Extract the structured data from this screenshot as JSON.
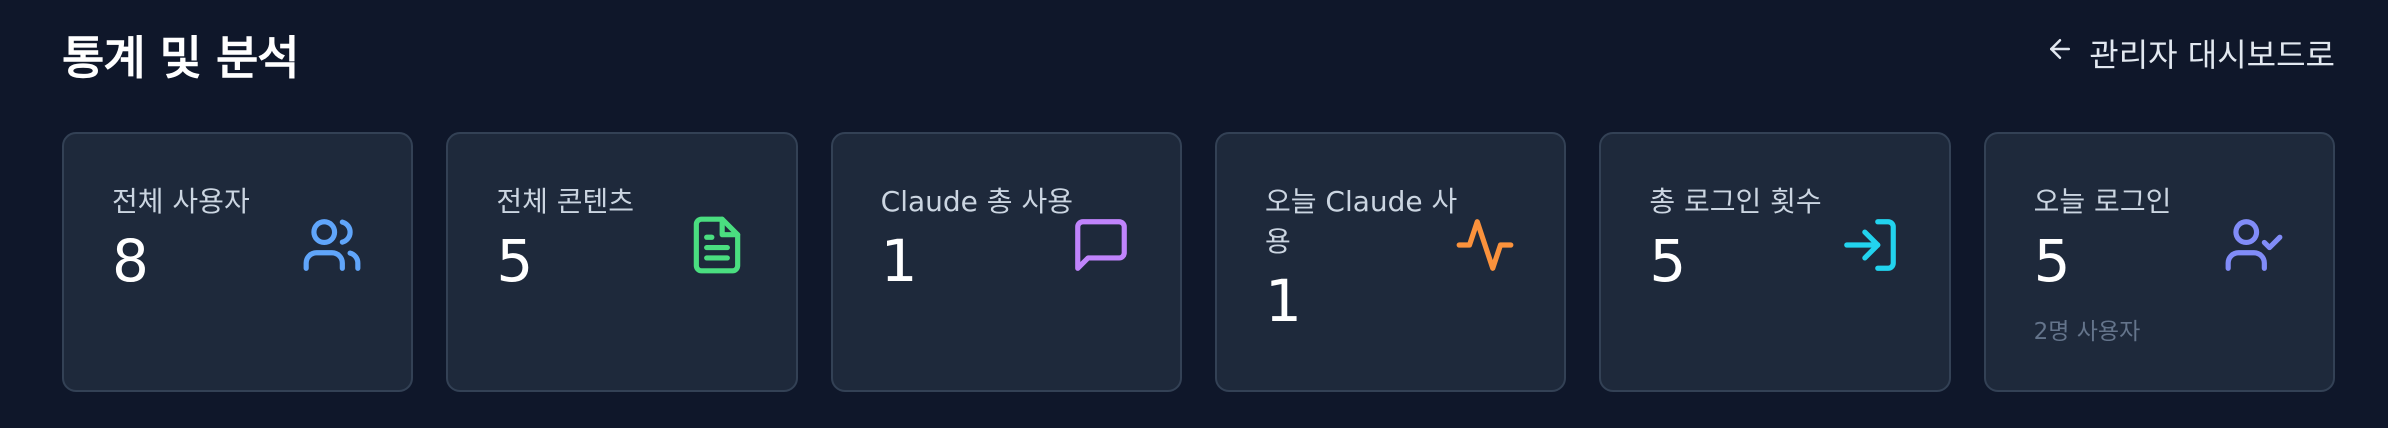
{
  "header": {
    "title": "통계 및 분석",
    "back_label": "관리자 대시보드로"
  },
  "cards": [
    {
      "label": "전체 사용자",
      "value": "8",
      "icon": "users-icon",
      "color": "#60a5fa"
    },
    {
      "label": "전체 콘텐츠",
      "value": "5",
      "icon": "file-text-icon",
      "color": "#4ade80"
    },
    {
      "label": "Claude 총 사용",
      "value": "1",
      "icon": "message-square-icon",
      "color": "#c084fc"
    },
    {
      "label": "오늘 Claude 사용",
      "value": "1",
      "icon": "activity-icon",
      "color": "#fb923c"
    },
    {
      "label": "총 로그인 횟수",
      "value": "5",
      "icon": "log-in-icon",
      "color": "#22d3ee"
    },
    {
      "label": "오늘 로그인",
      "value": "5",
      "sub": "2명 사용자",
      "icon": "user-check-icon",
      "color": "#818cf8"
    }
  ]
}
